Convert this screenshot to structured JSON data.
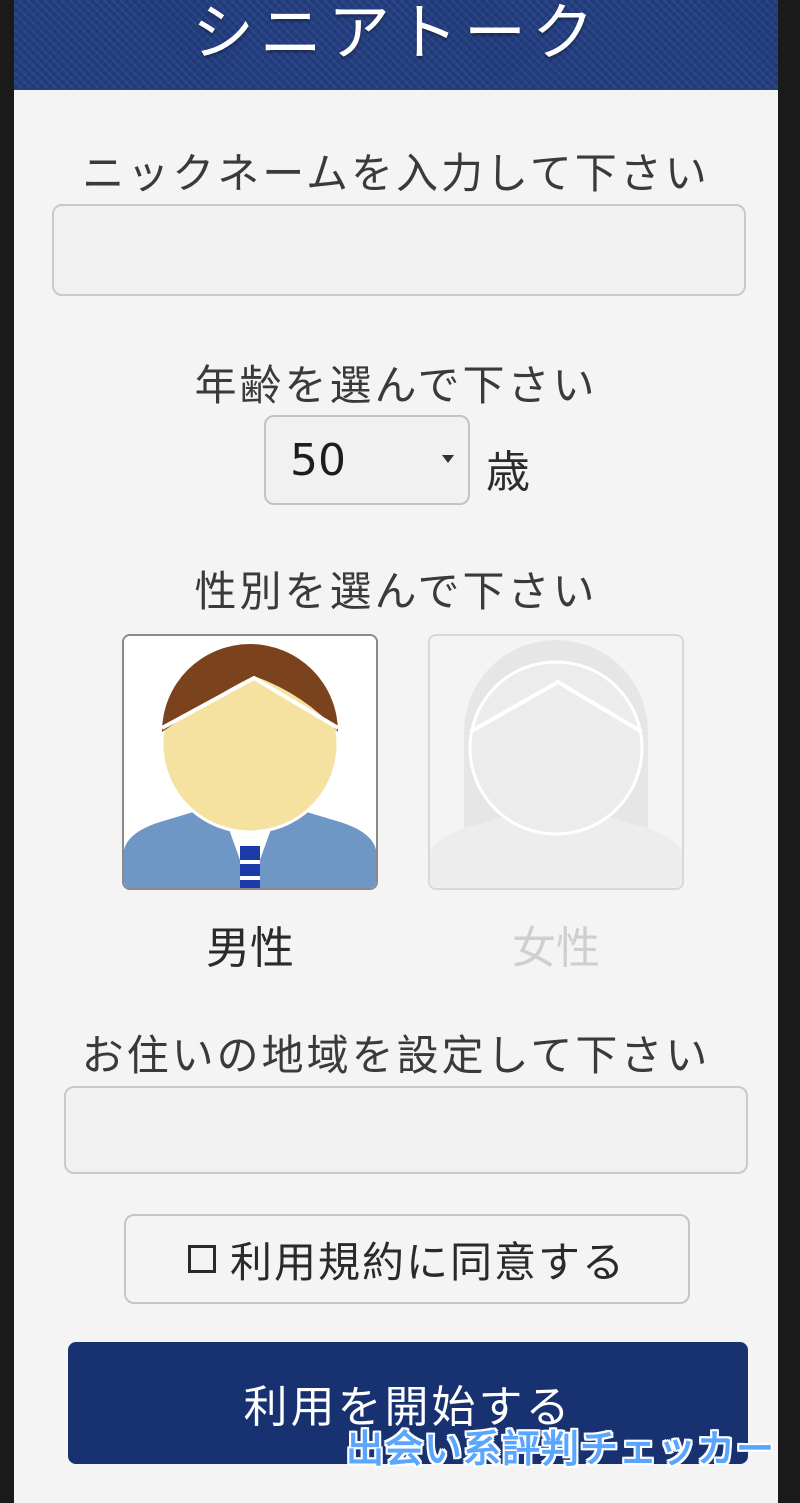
{
  "header": {
    "title": "シニアトーク"
  },
  "nickname": {
    "label": "ニックネームを入力して下さい",
    "value": "",
    "placeholder": ""
  },
  "age": {
    "label": "年齢を選んで下さい",
    "selected": "50",
    "unit": "歳"
  },
  "gender": {
    "label": "性別を選んで下さい",
    "options": [
      {
        "label": "男性",
        "selected": true
      },
      {
        "label": "女性",
        "selected": false
      }
    ]
  },
  "region": {
    "label": "お住いの地域を設定して下さい",
    "value": "",
    "placeholder": ""
  },
  "terms": {
    "label": "利用規約に同意する",
    "checked": false
  },
  "start_button": {
    "label": "利用を開始する"
  },
  "watermark": {
    "text": "出会い系評判チェッカー"
  },
  "colors": {
    "header_bg": "#233e80",
    "button_bg": "#183271",
    "male_hair": "#7b421e",
    "male_face": "#f5e2a0",
    "male_suit": "#6e97c6",
    "male_tie": "#1c3aa8",
    "female_inactive": "#e8e8e8",
    "watermark": "#5aa6ff"
  },
  "icons": {
    "male": "male-avatar-icon",
    "female": "female-avatar-icon",
    "checkbox": "checkbox-empty-icon"
  }
}
